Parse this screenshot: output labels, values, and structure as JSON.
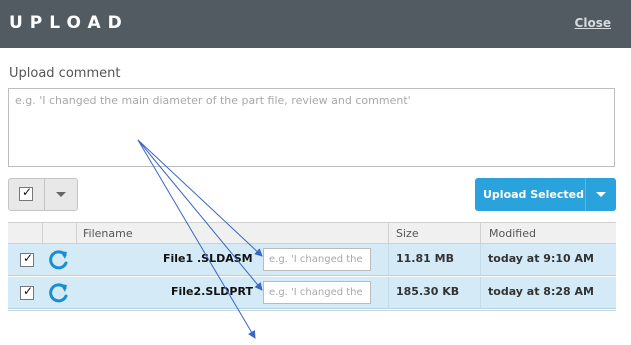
{
  "header": {
    "title": "UPLOAD",
    "close_label": "Close"
  },
  "comment": {
    "label": "Upload comment",
    "placeholder": "e.g. 'I changed the main diameter of the part file, review and comment'"
  },
  "toolbar": {
    "upload_label": "Upload Selected",
    "select_all_checked": true
  },
  "table": {
    "columns": [
      "Filename",
      "Size",
      "Modified"
    ],
    "rows": [
      {
        "checked": true,
        "filename": "File1 .SLDASM",
        "comment_placeholder": "e.g. 'I changed the main diameter of the part file, review and comment'",
        "size": "11.81 MB",
        "modified": "today at 9:10 AM"
      },
      {
        "checked": true,
        "filename": "File2.SLDPRT",
        "comment_placeholder": "e.g. 'I changed the main diameter of the part file, review and comment'",
        "size": "185.30 KB",
        "modified": "today at 8:28 AM"
      }
    ]
  },
  "icons": {
    "refresh": "refresh-icon",
    "caret": "chevron-down-icon",
    "check": "check-icon"
  },
  "colors": {
    "header_bg": "#525a62",
    "accent": "#2aa3dc",
    "row_bg": "#d4ebf7",
    "arrow": "#3a66c4"
  }
}
